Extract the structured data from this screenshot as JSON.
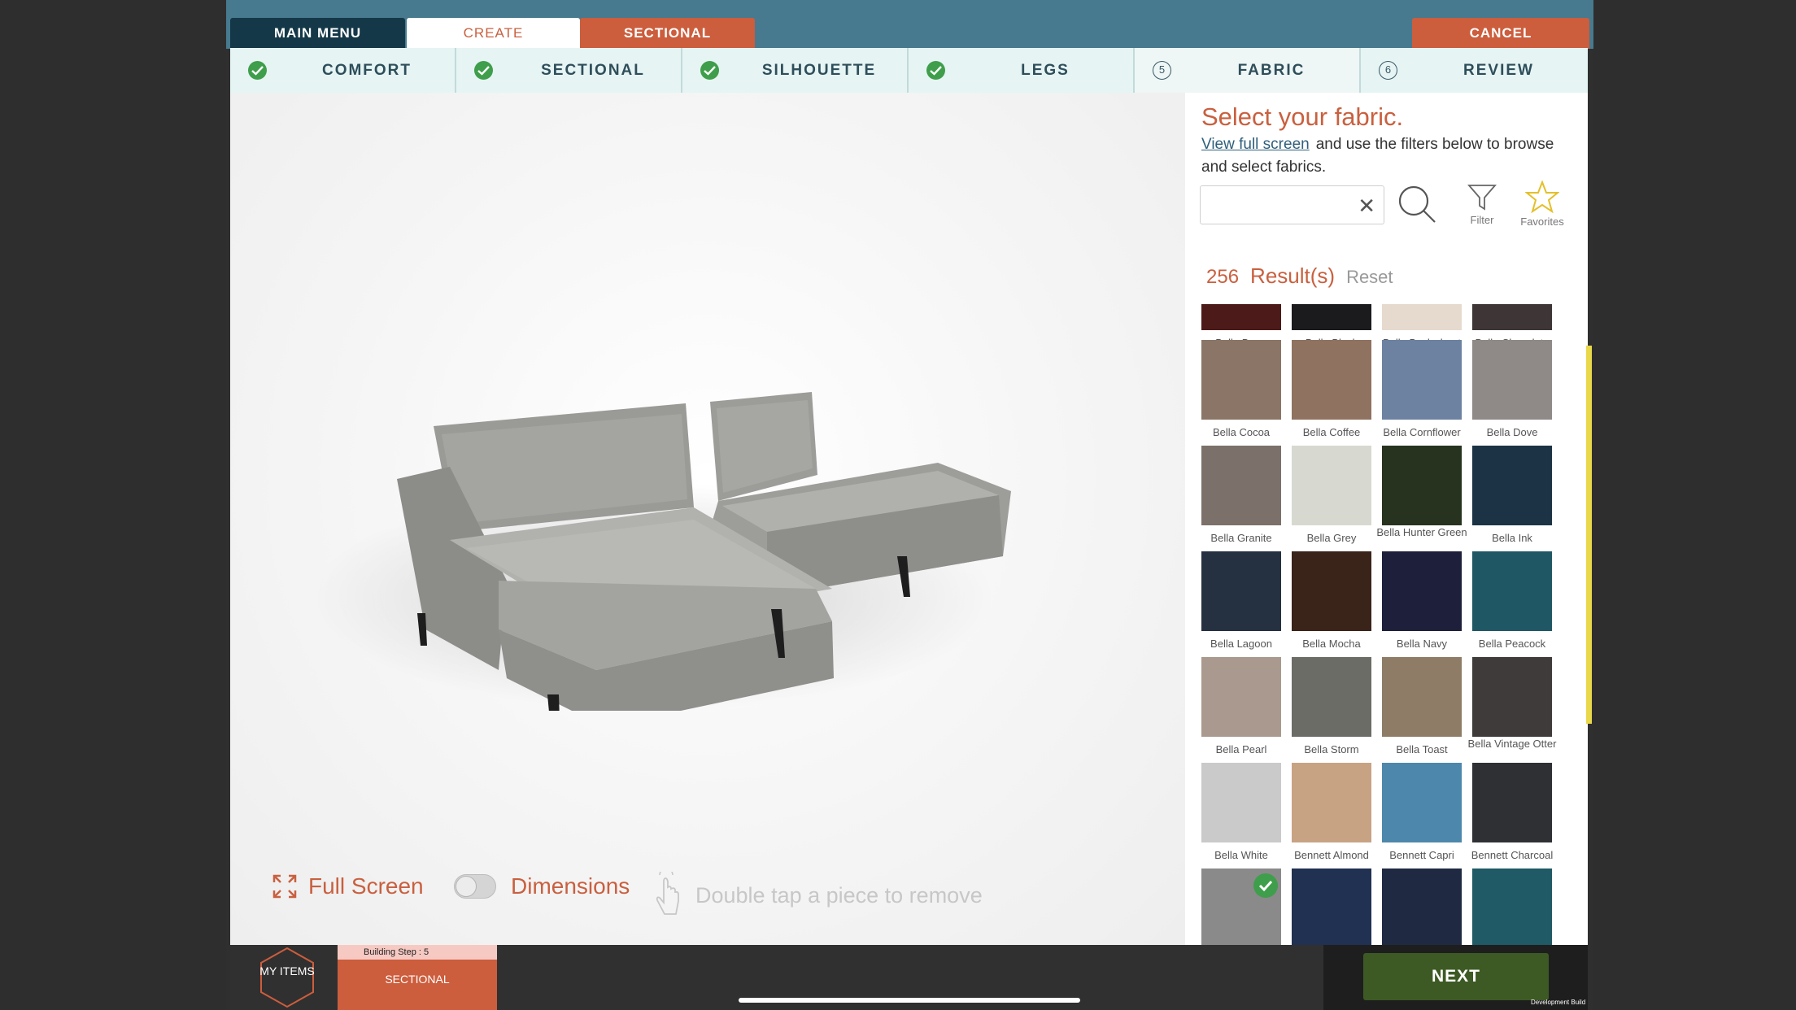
{
  "top_tabs": {
    "main_menu": "MAIN MENU",
    "create": "CREATE",
    "sectional": "SECTIONAL",
    "cancel": "CANCEL"
  },
  "steps": [
    {
      "label": "COMFORT",
      "status": "done"
    },
    {
      "label": "SECTIONAL",
      "status": "done"
    },
    {
      "label": "SILHOUETTE",
      "status": "done"
    },
    {
      "label": "LEGS",
      "status": "done"
    },
    {
      "label": "FABRIC",
      "status": "current",
      "number": "5"
    },
    {
      "label": "REVIEW",
      "status": "pending",
      "number": "6"
    }
  ],
  "viewer": {
    "full_screen": "Full Screen",
    "dimensions": "Dimensions",
    "hint": "Double tap a piece to remove"
  },
  "panel": {
    "title": "Select your fabric.",
    "link": "View full screen",
    "sub_text": "and use the filters below to browse and select fabrics.",
    "search_placeholder": "",
    "filter": "Filter",
    "favorites": "Favorites",
    "results_count": "256",
    "results_label": "Result(s)",
    "reset": "Reset"
  },
  "swatches": [
    {
      "name": "Bella Berry",
      "color": "#4b1a19"
    },
    {
      "name": "Bella Black",
      "color": "#1b1b1d"
    },
    {
      "name": "Bella Buckwheat",
      "color": "#e6dace"
    },
    {
      "name": "Bella Chocolate",
      "color": "#3d3536"
    },
    {
      "name": "Bella Cocoa",
      "color": "#8a7566"
    },
    {
      "name": "Bella Coffee",
      "color": "#8f7260"
    },
    {
      "name": "Bella Cornflower",
      "color": "#6c82a0"
    },
    {
      "name": "Bella Dove",
      "color": "#8f8a87"
    },
    {
      "name": "Bella Granite",
      "color": "#7c706b"
    },
    {
      "name": "Bella Grey",
      "color": "#d7d9d0"
    },
    {
      "name": "Bella Hunter Green",
      "color": "#27331f"
    },
    {
      "name": "Bella Ink",
      "color": "#1c3345"
    },
    {
      "name": "Bella Lagoon",
      "color": "#253040"
    },
    {
      "name": "Bella Mocha",
      "color": "#3a2319"
    },
    {
      "name": "Bella Navy",
      "color": "#1d1f3b"
    },
    {
      "name": "Bella Peacock",
      "color": "#1f5864"
    },
    {
      "name": "Bella Pearl",
      "color": "#a9998e"
    },
    {
      "name": "Bella Storm",
      "color": "#6b6c66"
    },
    {
      "name": "Bella Toast",
      "color": "#8e7c66"
    },
    {
      "name": "Bella Vintage Otter",
      "color": "#3f3b3b"
    },
    {
      "name": "Bella White",
      "color": "#cacaca"
    },
    {
      "name": "Bennett Almond",
      "color": "#c8a383"
    },
    {
      "name": "Bennett Capri",
      "color": "#4d87ab"
    },
    {
      "name": "Bennett Charcoal",
      "color": "#2f3034"
    },
    {
      "name": "",
      "color": "#8a8a8a",
      "selected": true
    },
    {
      "name": "",
      "color": "#213152"
    },
    {
      "name": "",
      "color": "#1f2a42"
    },
    {
      "name": "",
      "color": "#1f5a66"
    }
  ],
  "bottom": {
    "my_items": "MY ITEMS",
    "building_step": "Building Step : 5",
    "build_name": "SECTIONAL",
    "next": "NEXT",
    "dev_build": "Development Build"
  },
  "colors": {
    "accent": "#c9603f",
    "teal": "#477a8e",
    "next_green": "#3d5a24",
    "check_green": "#3f9e4b"
  }
}
